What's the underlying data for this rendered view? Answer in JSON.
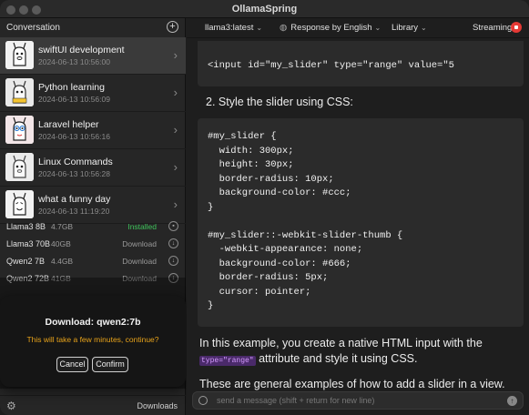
{
  "app": {
    "title": "OllamaSpring"
  },
  "sidebar": {
    "header_label": "Conversation",
    "add_icon": "plus-circle-icon",
    "conversations": [
      {
        "name": "swiftUI development",
        "date": "2024-06-13 10:56:00",
        "active": true
      },
      {
        "name": "Python learning",
        "date": "2024-06-13 10:56:09",
        "active": false
      },
      {
        "name": "Laravel helper",
        "date": "2024-06-13 10:56:16",
        "active": false
      },
      {
        "name": "Linux Commands",
        "date": "2024-06-13 10:56:28",
        "active": false
      },
      {
        "name": "what a funny day",
        "date": "2024-06-13 11:19:20",
        "active": false
      }
    ],
    "models": [
      {
        "name": "Llama3 8B",
        "size": "4.7GB",
        "status": "Installed",
        "icon": "trash-icon"
      },
      {
        "name": "Llama3 70B",
        "size": "40GB",
        "status": "Download",
        "icon": "download-icon"
      },
      {
        "name": "Qwen2 7B",
        "size": "4.4GB",
        "status": "Download",
        "icon": "download-icon"
      },
      {
        "name": "Qwen2 72B",
        "size": "41GB",
        "status": "Download",
        "icon": "download-icon"
      }
    ],
    "footer": {
      "settings_icon": "gear-icon",
      "downloads_label": "Downloads"
    }
  },
  "dialog": {
    "title": "Download: qwen2:7b",
    "message": "This will take a few minutes, continue?",
    "cancel_label": "Cancel",
    "confirm_label": "Confirm"
  },
  "toolbar": {
    "model": "llama3:latest",
    "response_language": "Response by English",
    "library": "Library",
    "streaming": "Streaming"
  },
  "chat": {
    "code_top": "<input id=\"my_slider\" type=\"range\" value=\"5",
    "step_2": "2.  Style the slider using CSS:",
    "code_css": "#my_slider {\n  width: 300px;\n  height: 30px;\n  border-radius: 10px;\n  background-color: #ccc;\n}\n\n#my_slider::-webkit-slider-thumb {\n  -webkit-appearance: none;\n  background-color: #666;\n  border-radius: 5px;\n  cursor: pointer;\n}",
    "para1_before": "In this example, you create a native HTML input with the ",
    "para1_code": "type=\"range\"",
    "para1_after": " attribute and style it using CSS.",
    "para2": "These are general examples of how to add a slider in a view. You can customize the appearance and"
  },
  "input": {
    "placeholder": "send a message (shift + return for new line)"
  }
}
